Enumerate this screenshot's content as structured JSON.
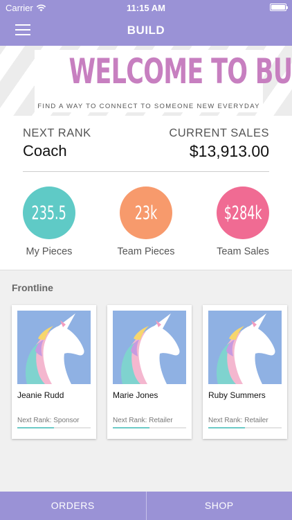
{
  "status_bar": {
    "carrier": "Carrier",
    "time": "11:15 AM"
  },
  "nav": {
    "title": "BUILD"
  },
  "banner": {
    "title": "WELCOME TO BUILD!",
    "subtitle": "FIND A WAY TO CONNECT TO SOMEONE NEW EVERYDAY"
  },
  "rank": {
    "label": "NEXT RANK",
    "value": "Coach"
  },
  "sales": {
    "label": "CURRENT SALES",
    "value": "$13,913.00"
  },
  "stats": [
    {
      "value": "235.5",
      "label": "My Pieces",
      "color": "#5fcac6"
    },
    {
      "value": "23k",
      "label": "Team Pieces",
      "color": "#f79a6c"
    },
    {
      "value": "$284k",
      "label": "Team Sales",
      "color": "#f06b93"
    }
  ],
  "frontline": {
    "title": "Frontline",
    "members": [
      {
        "name": "Jeanie Rudd",
        "next_rank": "Next Rank: Sponsor",
        "progress": 0.5
      },
      {
        "name": "Marie Jones",
        "next_rank": "Next Rank: Retailer",
        "progress": 0.5
      },
      {
        "name": "Ruby Summers",
        "next_rank": "Next Rank: Retailer",
        "progress": 0.5
      }
    ]
  },
  "tabs": {
    "orders": "ORDERS",
    "shop": "SHOP"
  },
  "icons": {
    "menu": "hamburger-menu-icon",
    "wifi": "wifi-icon",
    "battery": "battery-icon",
    "avatar": "unicorn-avatar-icon"
  },
  "colors": {
    "brand": "#9a92d6",
    "banner_title": "#c77fc0",
    "progress": "#6ccac7"
  }
}
